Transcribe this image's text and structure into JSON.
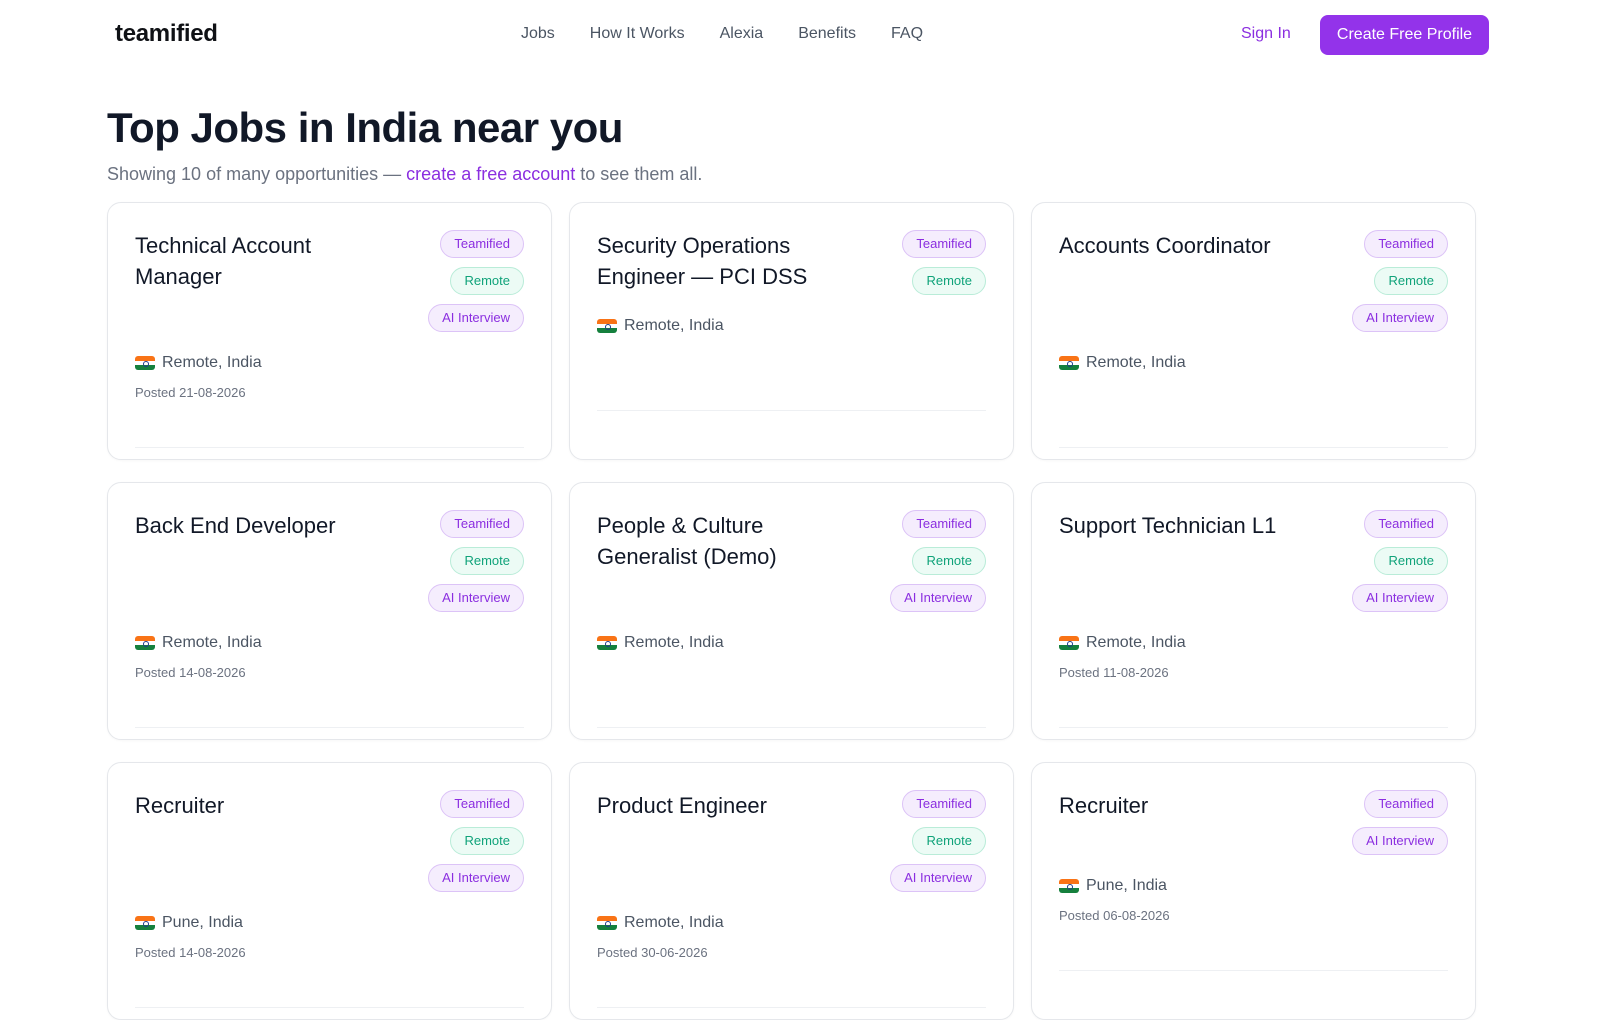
{
  "header": {
    "logo": "teamified",
    "nav": [
      "Jobs",
      "How It Works",
      "Alexia",
      "Benefits",
      "FAQ"
    ],
    "sign_in": "Sign In",
    "cta": "Create Free Profile"
  },
  "page": {
    "title": "Top Jobs in India near you",
    "subtitle_pre": "Showing 10 of many opportunities — ",
    "subtitle_link": "create a free account",
    "subtitle_post": " to see them all."
  },
  "colors": {
    "accent": "#9333ea",
    "link": "#8b2ee0",
    "remote_badge": "#10a37a"
  },
  "jobs": [
    {
      "title": "Technical Account Manager",
      "badges": [
        "Teamified",
        "Remote",
        "AI Interview"
      ],
      "location": "Remote, India",
      "posted": "Posted 21-08-2026"
    },
    {
      "title": "Security Operations Engineer — PCI DSS",
      "badges": [
        "Teamified",
        "Remote"
      ],
      "location": "Remote, India",
      "posted": ""
    },
    {
      "title": "Accounts Coordinator",
      "badges": [
        "Teamified",
        "Remote",
        "AI Interview"
      ],
      "location": "Remote, India",
      "posted": ""
    },
    {
      "title": "Back End Developer",
      "badges": [
        "Teamified",
        "Remote",
        "AI Interview"
      ],
      "location": "Remote, India",
      "posted": "Posted 14-08-2026"
    },
    {
      "title": "People & Culture Generalist (Demo)",
      "badges": [
        "Teamified",
        "Remote",
        "AI Interview"
      ],
      "location": "Remote, India",
      "posted": ""
    },
    {
      "title": "Support Technician L1",
      "badges": [
        "Teamified",
        "Remote",
        "AI Interview"
      ],
      "location": "Remote, India",
      "posted": "Posted 11-08-2026"
    },
    {
      "title": "Recruiter",
      "badges": [
        "Teamified",
        "Remote",
        "AI Interview"
      ],
      "location": "Pune, India",
      "posted": "Posted 14-08-2026"
    },
    {
      "title": "Product Engineer",
      "badges": [
        "Teamified",
        "Remote",
        "AI Interview"
      ],
      "location": "Remote, India",
      "posted": "Posted 30-06-2026"
    },
    {
      "title": "Recruiter",
      "badges": [
        "Teamified",
        "AI Interview"
      ],
      "location": "Pune, India",
      "posted": "Posted 06-08-2026"
    }
  ]
}
